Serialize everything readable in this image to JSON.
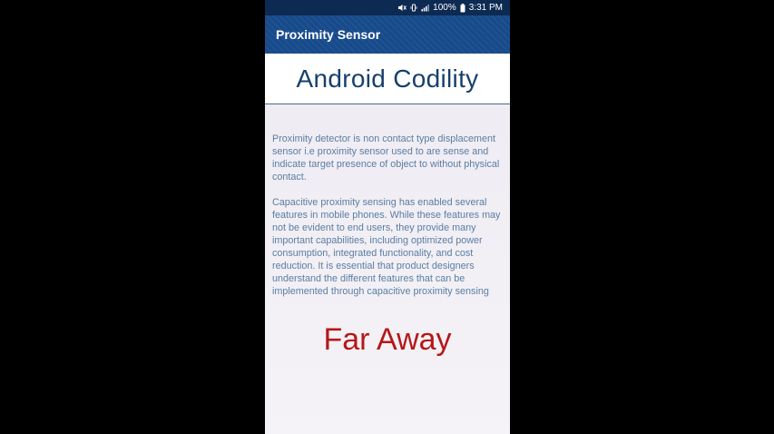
{
  "status_bar": {
    "battery": "100%",
    "time": "3:31 PM",
    "icons": [
      "mute-icon",
      "vibrate-icon",
      "signal-icon",
      "battery-icon"
    ]
  },
  "app_bar": {
    "title": "Proximity Sensor"
  },
  "main": {
    "heading": "Android Codility",
    "paragraphs": [
      "Proximity detector is non contact type displacement sensor i.e proximity sensor used to are sense and indicate target presence of object to without physical contact.",
      "Capacitive proximity sensing has enabled several features in mobile phones. While these features may not be evident to end users, they provide many important capabilities, including optimized power consumption, integrated functionality, and cost reduction. It is essential that product designers understand the different features that can be implemented through capacitive proximity sensing"
    ],
    "proximity_status": "Far Away"
  },
  "colors": {
    "status_bar_bg": "#0d2a52",
    "app_bar_bg": "#174a8b",
    "heading_text": "#17406b",
    "paragraph_text": "#5a7ea2",
    "status_text": "#b41818"
  }
}
